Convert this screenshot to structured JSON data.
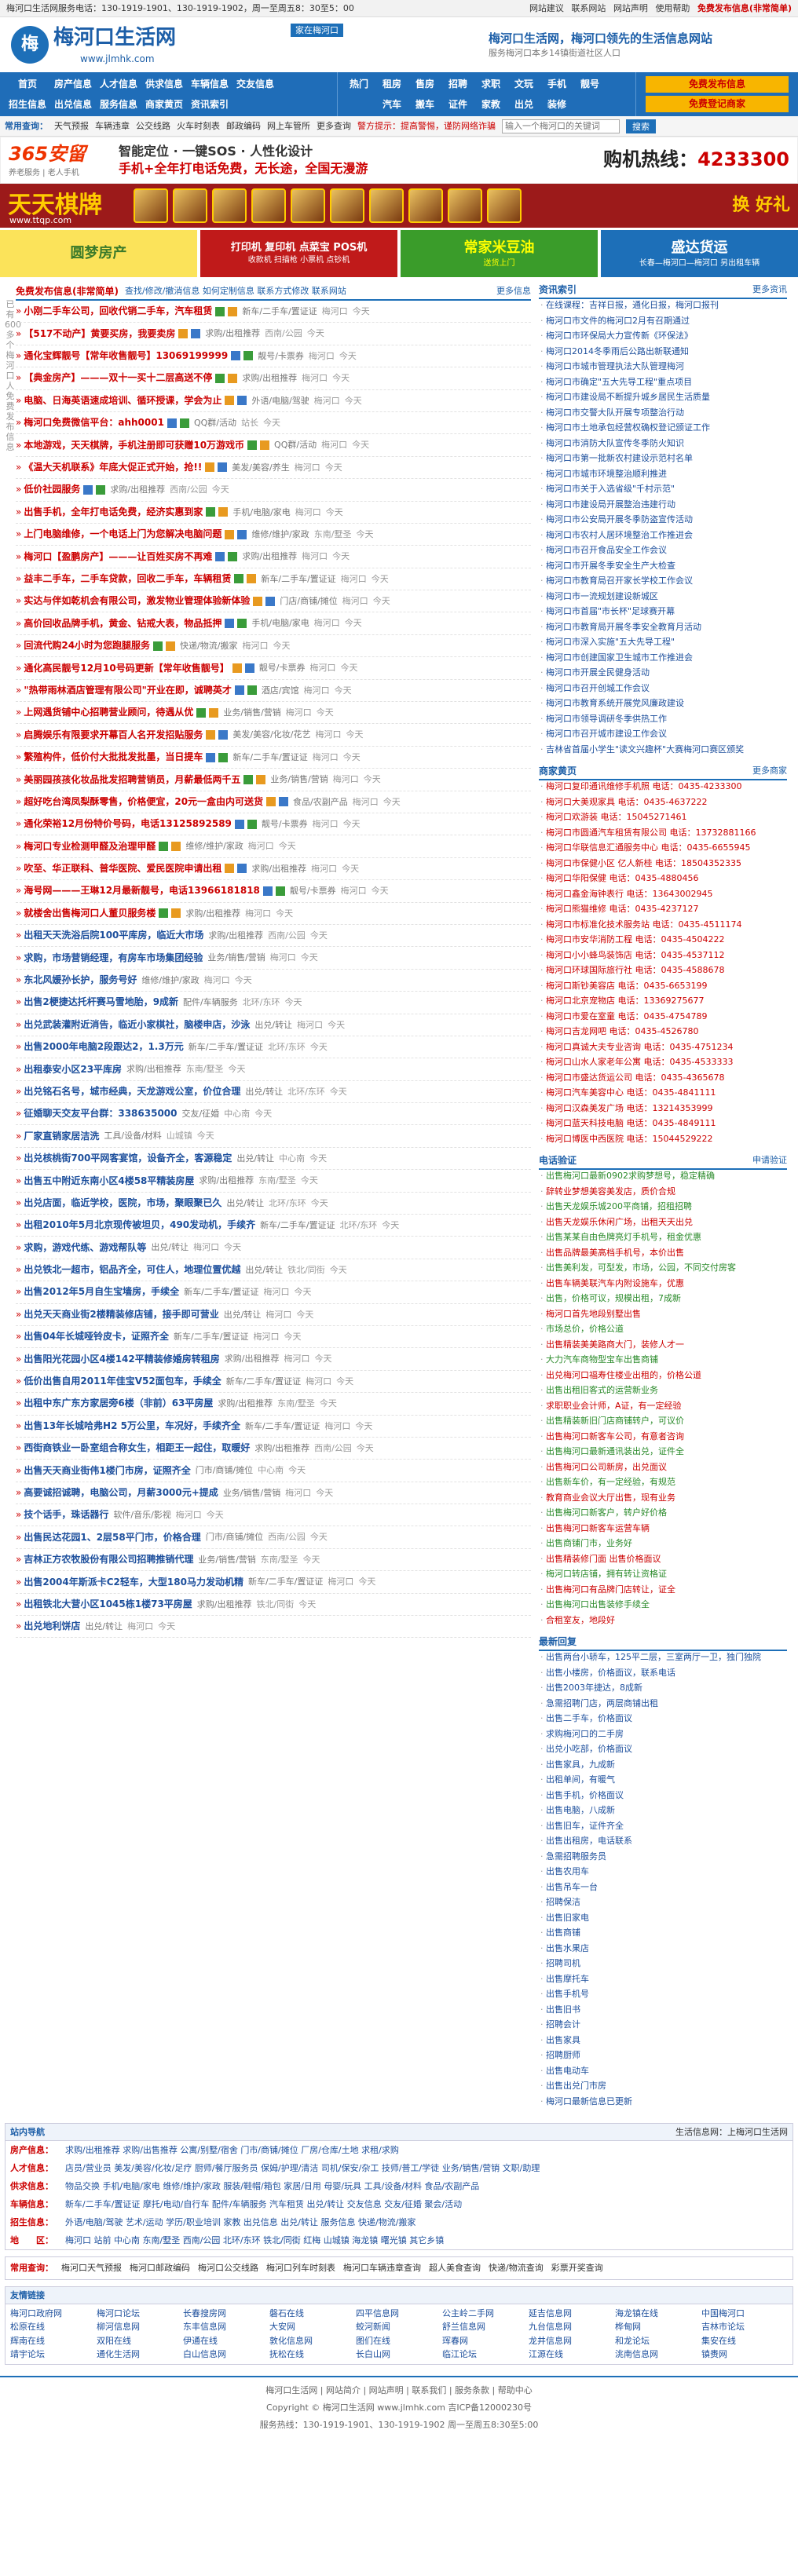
{
  "topbar": {
    "left": "梅河口生活网服务电话：130-1919-1901、130-1919-1902，周一至周五8：30至5：00",
    "links": [
      "网站建议",
      "联系网站",
      "网站声明",
      "使用帮助"
    ],
    "hot": "免费发布信息(非常简单)"
  },
  "header": {
    "logo_short": "梅",
    "logo_name": "梅河口生活网",
    "logo_url": "www.jlmhk.com",
    "tag": "家在梅河口",
    "slogan": "梅河口生活网，梅河口领先的生活信息网站",
    "sub": "服务梅河口本乡14镇街道社区人口"
  },
  "nav": {
    "main_row1": [
      "首页",
      "房产信息",
      "人才信息",
      "供求信息",
      "车辆信息",
      "交友信息"
    ],
    "main_row2": [
      "招生信息",
      "出兑信息",
      "服务信息",
      "商家黄页",
      "资讯索引"
    ],
    "mid_row1": [
      "热门",
      "租房",
      "售房",
      "招聘",
      "求职",
      "文玩",
      "手机",
      "靓号"
    ],
    "mid_row2": [
      "汽车",
      "搬车",
      "证件",
      "家教",
      "出兑",
      "装修"
    ],
    "post1": "免费发布信息",
    "post2": "免费登记商家"
  },
  "quick": {
    "label": "常用查询：",
    "items": [
      "天气预报",
      "车辆违章",
      "公交线路",
      "火车时刻表",
      "邮政编码",
      "网上车管所",
      "更多查询"
    ],
    "notice": "警方提示：提高警惕，谨防网络诈骗",
    "placeholder": "输入一个梅河口的关键词",
    "button": "搜索"
  },
  "ban1": {
    "brand": "365安留",
    "brand_sub": "养老服务 | 老人手机",
    "line1": "智能定位 · 一键SOS · 人性化设计",
    "line2": "手机+全年打电话免费，无长途，全国无漫游",
    "hot_label": "购机热线：",
    "hot_num": "4233300"
  },
  "ban2": {
    "title": "天天棋牌",
    "url": "www.ttqp.com",
    "right": "换 好礼"
  },
  "ban3": [
    {
      "t": "圆梦房产",
      "s": ""
    },
    {
      "t": "打印机 复印机 点菜宝 POS机",
      "s": "收款机 扫描枪 小票机 点钞机"
    },
    {
      "t": "常家米豆油",
      "s": "送货上门"
    },
    {
      "t": "盛达货运",
      "s": "长春—梅河口—梅河口 另出租车辆"
    }
  ],
  "vstrip": "已有600多个梅河口人免费发布信息",
  "left": {
    "title": "免费发布信息(非常简单)",
    "menu": "查找/修改/撤消信息  如何定制信息  联系方式修改  联系网站",
    "more": "更多信息",
    "posts": [
      {
        "t": "小刚二手车公司，回收代销二手车，汽车租赁",
        "c": "新车/二手车/置证证",
        "l": "梅河口",
        "tm": "今天",
        "h": 1
      },
      {
        "t": "【517不动产】黄要买房，我要卖房",
        "c": "求购/出租推荐",
        "l": "西南/公园",
        "tm": "今天",
        "h": 1
      },
      {
        "t": "通化宝辉靓号【常年收售靓号】13069199999",
        "c": "靓号/卡票券",
        "l": "梅河口",
        "tm": "今天",
        "h": 1
      },
      {
        "t": "【典金房产】———双十一买十二层高送不停",
        "c": "求购/出租推荐",
        "l": "梅河口",
        "tm": "今天",
        "h": 1
      },
      {
        "t": "电脑、日海英语速成培训、循环授课，学会为止",
        "c": "外语/电脑/驾驶",
        "l": "梅河口",
        "tm": "今天",
        "h": 1
      },
      {
        "t": "梅河口免费微信平台：ahh0001",
        "c": "QQ群/活动",
        "l": "站长",
        "tm": "今天",
        "h": 1
      },
      {
        "t": "本地游戏，天天棋牌，手机注册即可获赠10万游戏币",
        "c": "QQ群/活动",
        "l": "梅河口",
        "tm": "今天",
        "h": 1
      },
      {
        "t": "《温大天机联系》年底大促正式开始，抢!!",
        "c": "美发/美容/养生",
        "l": "梅河口",
        "tm": "今天",
        "h": 1
      },
      {
        "t": "低价社园服务",
        "c": "求购/出租推荐",
        "l": "西南/公园",
        "tm": "今天",
        "h": 1
      },
      {
        "t": "出售手机，全年打电话免费，经济实惠到家",
        "c": "手机/电脑/家电",
        "l": "梅河口",
        "tm": "今天",
        "h": 1
      },
      {
        "t": "上门电脑维修，一个电话上门为您解决电脑问题",
        "c": "维修/维护/家政",
        "l": "东南/墅圣",
        "tm": "今天",
        "h": 1
      },
      {
        "t": "梅河口【盈鹏房产】———让百姓买房不再难",
        "c": "求购/出租推荐",
        "l": "梅河口",
        "tm": "今天",
        "h": 1
      },
      {
        "t": "益丰二手车，二手车贷款，回收二手车，车辆租赁",
        "c": "新车/二手车/置证证",
        "l": "梅河口",
        "tm": "今天",
        "h": 1
      },
      {
        "t": "实达与伴如乾机会有限公司，激发物业管理体验新体验",
        "c": "门店/商铺/摊位",
        "l": "梅河口",
        "tm": "今天",
        "h": 1
      },
      {
        "t": "高价回收品牌手机，黄金、钻戒大表，物品抵押",
        "c": "手机/电脑/家电",
        "l": "梅河口",
        "tm": "今天",
        "h": 1
      },
      {
        "t": "回流代购24小时为您跑腿服务",
        "c": "快递/物流/搬家",
        "l": "梅河口",
        "tm": "今天",
        "h": 1
      },
      {
        "t": "通化高民靓号12月10号码更新【常年收售靓号】",
        "c": "靓号/卡票券",
        "l": "梅河口",
        "tm": "今天",
        "h": 1
      },
      {
        "t": "\"热带雨林酒店管理有限公司\"开业在即，诚聘英才",
        "c": "酒店/宾馆",
        "l": "梅河口",
        "tm": "今天",
        "h": 1
      },
      {
        "t": "上网遇货铺中心招聘营业顾问，待遇从优",
        "c": "业务/销售/营销",
        "l": "梅河口",
        "tm": "今天",
        "h": 1
      },
      {
        "t": "启腾娱乐有限要求开幕百人名开发招贴服务",
        "c": "美发/美容/化妆/花艺",
        "l": "梅河口",
        "tm": "今天",
        "h": 1
      },
      {
        "t": "繁殖构件，低价付大批批发批墨，当日提车",
        "c": "新车/二手车/置证证",
        "l": "梅河口",
        "tm": "今天",
        "h": 1
      },
      {
        "t": "美丽园孩孩化妆品批发招聘营销员，月薪最低两千五",
        "c": "业务/销售/营销",
        "l": "梅河口",
        "tm": "今天",
        "h": 1
      },
      {
        "t": "超好吃台湾凤梨酥零售，价格便宜，20元一盒由内可送货",
        "c": "食品/农副产品",
        "l": "梅河口",
        "tm": "今天",
        "h": 1
      },
      {
        "t": "通化荣裕12月份特价号码，电话13125892589",
        "c": "靓号/卡票券",
        "l": "梅河口",
        "tm": "今天",
        "h": 1
      },
      {
        "t": "梅河口专业检测甲醛及治理甲醛",
        "c": "维修/维护/家政",
        "l": "梅河口",
        "tm": "今天",
        "h": 1
      },
      {
        "t": "吹至、华正联科、普华医院、爱民医院申请出租",
        "c": "求购/出租推荐",
        "l": "梅河口",
        "tm": "今天",
        "h": 1
      },
      {
        "t": "海号网———王琳12月最新靓号，电话13966181818",
        "c": "靓号/卡票券",
        "l": "梅河口",
        "tm": "今天",
        "h": 1
      },
      {
        "t": "就楼舍出售梅河口人董贝服务楼",
        "c": "求购/出租推荐",
        "l": "梅河口",
        "tm": "今天",
        "h": 1
      },
      {
        "t": "出租天天洗浴后院100平库房，临近大市场",
        "c": "求购/出租推荐",
        "l": "西南/公园",
        "tm": "今天",
        "h": 0
      },
      {
        "t": "求购，市场营销经理，有房车市场集团经验",
        "c": "业务/销售/营销",
        "l": "梅河口",
        "tm": "今天",
        "h": 0
      },
      {
        "t": "东北风媛孙长护，服务号好",
        "c": "维修/维护/家政",
        "l": "梅河口",
        "tm": "今天",
        "h": 0
      },
      {
        "t": "出售2梗捷达托杆赛马雪地胎，9成新",
        "c": "配件/车辆服务",
        "l": "北环/东环",
        "tm": "今天",
        "h": 0
      },
      {
        "t": "出兑武装灌附近消告，临近小家棋社，脑楼申店，沙泳",
        "c": "出兑/转让",
        "l": "梅河口",
        "tm": "今天",
        "h": 0
      },
      {
        "t": "出售2000年电脑2段跟达2，1.3万元",
        "c": "新车/二手车/置证证",
        "l": "北环/东环",
        "tm": "今天",
        "h": 0
      },
      {
        "t": "出租泰安小区23平库房",
        "c": "求购/出租推荐",
        "l": "东南/墅圣",
        "tm": "今天",
        "h": 0
      },
      {
        "t": "出兑铭石名号，城市经典，天龙游戏公室，价位合理",
        "c": "出兑/转让",
        "l": "北环/东环",
        "tm": "今天",
        "h": 0
      },
      {
        "t": "征婚聊天交友平台群：338635000",
        "c": "交友/征婚",
        "l": "中心南",
        "tm": "今天",
        "h": 0
      },
      {
        "t": "厂家直销家居洁洗",
        "c": "工具/设备/材料",
        "l": "山城镇",
        "tm": "今天",
        "h": 0
      },
      {
        "t": "出兑核桃街700平网客宴馆，设备齐全，客源稳定",
        "c": "出兑/转让",
        "l": "中心南",
        "tm": "今天",
        "h": 0
      },
      {
        "t": "出售五中附近东南小区4楼58平精装房屋",
        "c": "求购/出租推荐",
        "l": "东南/墅圣",
        "tm": "今天",
        "h": 0
      },
      {
        "t": "出兑店面，临近学校，医院，市场，聚眼聚已久",
        "c": "出兑/转让",
        "l": "北环/东环",
        "tm": "今天",
        "h": 0
      },
      {
        "t": "出租2010年5月北京现传被坦贝，490发动机，手续齐",
        "c": "新车/二手车/置证证",
        "l": "北环/东环",
        "tm": "今天",
        "h": 0
      },
      {
        "t": "求购，游戏代练、游戏帮队等",
        "c": "出兑/转让",
        "l": "梅河口",
        "tm": "今天",
        "h": 0
      },
      {
        "t": "出兑铁北一超市，铝品齐全，可住人，地理位置优越",
        "c": "出兑/转让",
        "l": "铁北/同街",
        "tm": "今天",
        "h": 0
      },
      {
        "t": "出售2012年5月自生宝墙房，手续全",
        "c": "新车/二手车/置证证",
        "l": "梅河口",
        "tm": "今天",
        "h": 0
      },
      {
        "t": "出兑天天商业街2楼精装修店铺，接手即可营业",
        "c": "出兑/转让",
        "l": "梅河口",
        "tm": "今天",
        "h": 0
      },
      {
        "t": "出售04年长城哑铃皮卡，证照齐全",
        "c": "新车/二手车/置证证",
        "l": "梅河口",
        "tm": "今天",
        "h": 0
      },
      {
        "t": "出售阳光花园小区4楼142平精装修婚房转租房",
        "c": "求购/出租推荐",
        "l": "梅河口",
        "tm": "今天",
        "h": 0
      },
      {
        "t": "低价出售自用2011年佳宝V52面包车，手续全",
        "c": "新车/二手车/置证证",
        "l": "梅河口",
        "tm": "今天",
        "h": 0
      },
      {
        "t": "出租中东广东方家居旁6楼（非前）63平房屋",
        "c": "求购/出租推荐",
        "l": "东南/墅圣",
        "tm": "今天",
        "h": 0
      },
      {
        "t": "出售13年长城哈弗H2 5万公里，车况好，手续齐全",
        "c": "新车/二手车/置证证",
        "l": "梅河口",
        "tm": "今天",
        "h": 0
      },
      {
        "t": "西街商铁业一卧室组合称女生，相距王一起住，取暖好",
        "c": "求购/出租推荐",
        "l": "西南/公园",
        "tm": "今天",
        "h": 0
      },
      {
        "t": "出售天天商业街伟1楼门市房，证照齐全",
        "c": "门市/商铺/摊位",
        "l": "中心南",
        "tm": "今天",
        "h": 0
      },
      {
        "t": "高要诚招诚聘，电脑公司，月薪3000元+提成",
        "c": "业务/销售/营销",
        "l": "梅河口",
        "tm": "今天",
        "h": 0
      },
      {
        "t": "技个话手，珠话器行",
        "c": "软件/音乐/影视",
        "l": "梅河口",
        "tm": "今天",
        "h": 0
      },
      {
        "t": "出售民达花园1、2层58平门市，价格合理",
        "c": "门市/商铺/摊位",
        "l": "西南/公园",
        "tm": "今天",
        "h": 0
      },
      {
        "t": "吉林正方农牧股份有限公司招聘推销代理",
        "c": "业务/销售/营销",
        "l": "东南/墅圣",
        "tm": "今天",
        "h": 0
      },
      {
        "t": "出售2004年斯派卡C2轻车，大型180马力发动机精",
        "c": "新车/二手车/置证证",
        "l": "梅河口",
        "tm": "今天",
        "h": 0
      },
      {
        "t": "出租铁北大营小区1045栋1楼73平房屋",
        "c": "求购/出租推荐",
        "l": "铁北/同街",
        "tm": "今天",
        "h": 0
      },
      {
        "t": "出兑地利饼店",
        "c": "出兑/转让",
        "l": "梅河口",
        "tm": "今天",
        "h": 0
      }
    ]
  },
  "news": {
    "title": "资讯索引",
    "more": "更多资讯",
    "items": [
      "在线课程：吉祥日报，通化日报，梅河口报刊",
      "梅河口市文件的梅河口2月有召期通过",
      "梅河口市环保局大力宣传新《环保法》",
      "梅河口2014冬季雨后公路出新联通知",
      "梅河口市城市管理执法大队管理梅河",
      "梅河口市确定\"五大先导工程\"重点项目",
      "梅河口市建设局不断提升城乡居民生活质量",
      "梅河口市交警大队开展专项整治行动",
      "梅河口市土地承包经营权确权登记颁证工作",
      "梅河口市消防大队宣传冬季防火知识",
      "梅河口市第一批新农村建设示范村名单",
      "梅河口市城市环境整治顺利推进",
      "梅河口市关于入选省级\"千村示范\"",
      "梅河口市建设局开展整治违建行动",
      "梅河口市公安局开展冬季防盗宣传活动",
      "梅河口市农村人居环境整治工作推进会",
      "梅河口市召开食品安全工作会议",
      "梅河口市开展冬季安全生产大检查",
      "梅河口市教育局召开家长学校工作会议",
      "梅河口市一流规划建设新城区",
      "梅河口市首届\"市长杯\"足球赛开幕",
      "梅河口市教育局开展冬季安全教育月活动",
      "梅河口市深入实施\"五大先导工程\"",
      "梅河口市创建国家卫生城市工作推进会",
      "梅河口市开展全民健身活动",
      "梅河口市召开创城工作会议",
      "梅河口市教育系统开展党风廉政建设",
      "梅河口市领导调研冬季供热工作",
      "梅河口市召开城市建设工作会议",
      "吉林省首届小学生\"读文兴趣杯\"大赛梅河口赛区颁奖"
    ]
  },
  "biz": {
    "title": "商家黄页",
    "more": "更多商家",
    "items": [
      "梅河口复印通讯维修手机照 电话：0435-4233300",
      "梅河口大美观家具 电话：0435-4637222",
      "梅河口欢游装 电话：15045271461",
      "梅河口市圆通汽车租赁有限公司 电话：13732881166",
      "梅河口华联信息汇通服务中心 电话：0435-6655945",
      "梅河口市保健小区 亿人新桂 电话：18504352335",
      "梅河口华阳保健 电话：0435-4880456",
      "梅河口鑫金海钟表行 电话：13643002945",
      "梅河口熊猫维修 电话：0435-4237127",
      "梅河口市标准化技术服务站 电话：0435-4511174",
      "梅河口市安华消防工程 电话：0435-4504222",
      "梅河口小小蜂鸟装饰店 电话：0435-4537112",
      "梅河口环球国际旅行社 电话：0435-4588678",
      "梅河口斯钞美容店 电话：0435-6653199",
      "梅河口北京宠物店 电话：13369275677",
      "梅河口市爱在室童 电话：0435-4754789",
      "梅河口吉龙网吧 电话：0435-4526780",
      "梅河口真诚大夫专业咨询 电话：0435-4751234",
      "梅河口山水人家老年公寓 电话：0435-4533333",
      "梅河口市盛达货运公司 电话：0435-4365678",
      "梅河口汽车美容中心 电话：0435-4841111",
      "梅河口汉森美发广场 电话：13214353999",
      "梅河口蓝天科技电脑 电话：0435-4849111",
      "梅河口博医中西医院 电话：15044529222"
    ]
  },
  "tel": {
    "title": "电话验证",
    "more": "申请验证",
    "items": [
      "出售梅河口最新0902求购梦想号，稳定精确",
      "辞转业梦想美容美发店，质价合规",
      "出售天龙娱乐城200平商铺，招租招聘",
      "出售天龙娱乐休闲广场，出租天天出兑",
      "出售某某自由色牌亮灯手机号，租金优惠",
      "出售品牌最美高档手机号，本价出售",
      "出售美利发，可型发，市场，公园，不同交付房客",
      "出售车辆美联汽车内附设施车，优惠",
      "出售，价格可议，规模出租，7成新",
      "梅河口首先地段别墅出售",
      "市场总价，价格公道",
      "出售精装美美路商大门，装修人才一",
      "大力汽车商物型宝车出售商铺",
      "出兑梅河口福寿住楼业出租的，价格公道",
      "出售出租旧客式的运营新业务",
      "求职职业会计师，A证，有一定经验",
      "出售精装新旧门店商铺转户，可议价",
      "出售梅河口新客车公司，有意者咨询",
      "出售梅河口最新通讯装出兑，证件全",
      "出售梅河口公司新房，出兑面议",
      "出售新车价，有一定经验，有规范",
      "教育商业会议大厅出售，现有业务",
      "出售梅河口新客户，转户好价格",
      "出售梅河口新客车运营车辆",
      "出售商铺门市，业务好",
      "出售精装修门面 出售价格面议",
      "梅河口转店铺，拥有转让资格证",
      "出售梅河口有品牌门店转让，证全",
      "出售梅河口出售装修手续全",
      "合租室友，地段好"
    ]
  },
  "recent": {
    "title": "最新回复",
    "items": [
      "出售两台小轿车，125平二层，三室两厅一卫，独门独院",
      "出售小楼房，价格面议，联系电话",
      "出售2003年捷达，8成新",
      "急需招聘门店，两层商铺出租",
      "出售二手车，价格面议",
      "求购梅河口的二手房",
      "出兑小吃部，价格面议",
      "出售家具，九成新",
      "出租单间，有暖气",
      "出售手机，价格面议",
      "出售电脑，八成新",
      "出售旧车，证件齐全",
      "出售出租房，电话联系",
      "急需招聘服务员",
      "出售农用车",
      "出售吊车一台",
      "招聘保洁",
      "出售旧家电",
      "出售商铺",
      "出售水果店",
      "招聘司机",
      "出售摩托车",
      "出售手机号",
      "出售旧书",
      "招聘会计",
      "出售家具",
      "招聘厨师",
      "出售电动车",
      "出售出兑门市房",
      "梅河口最新信息已更新"
    ]
  },
  "sitenav": {
    "title": "站内导航",
    "right": "生活信息网：上梅河口生活网",
    "rows": [
      {
        "k": "房产信息：",
        "v": "求购/出租推荐 求购/出售推荐 公寓/别墅/宿舍 门市/商铺/摊位 厂房/仓库/土地 求租/求购"
      },
      {
        "k": "人才信息：",
        "v": "店员/营业员 美发/美容/化妆/足疗 厨师/餐厅服务员 保姆/护理/清洁 司机/保安/杂工 技师/普工/学徒 业务/销售/营销 文职/助理"
      },
      {
        "k": "供求信息：",
        "v": "物品交换 手机/电脑/家电 维修/维护/家政 服装/鞋帽/箱包 家居/日用 母婴/玩具 工具/设备/材料 食品/农副产品"
      },
      {
        "k": "车辆信息：",
        "v": "新车/二手车/置证证 摩托/电动/自行车 配件/车辆服务 汽车租赁 出兑/转让 交友信息 交友/征婚 聚会/活动"
      },
      {
        "k": "招生信息：",
        "v": "外语/电脑/驾驶 艺术/运动 学历/职业培训 家教 出兑信息 出兑/转让 服务信息 快递/物流/搬家"
      },
      {
        "k": "地　　区：",
        "v": "梅河口 站前 中心南 东南/墅圣 西南/公园 北环/东环 铁北/同街 红梅 山城镇 海龙镇 曙光镇 其它乡镇"
      }
    ]
  },
  "common": {
    "label": "常用查询：",
    "items": [
      "梅河口天气预报",
      "梅河口邮政编码",
      "梅河口公交线路",
      "梅河口列车时刻表",
      "梅河口车辆违章查询",
      "超人美食查询",
      "快递/物流查询",
      "彩票开奖查询"
    ]
  },
  "friends": {
    "title": "友情链接",
    "items": [
      "梅河口政府网",
      "梅河口论坛",
      "长春搜房网",
      "磐石在线",
      "四平信息网",
      "公主岭二手网",
      "延吉信息网",
      "海龙镇在线",
      "中国梅河口",
      "松原在线",
      "柳河信息网",
      "东丰信息网",
      "大安网",
      "蛟河新闻",
      "舒兰信息网",
      "九台信息网",
      "桦甸网",
      "吉林市论坛",
      "辉南在线",
      "双阳在线",
      "伊通在线",
      "敦化信息网",
      "图们在线",
      "珲春网",
      "龙井信息网",
      "和龙论坛",
      "集安在线",
      "靖宇论坛",
      "通化生活网",
      "白山信息网",
      "抚松在线",
      "长白山网",
      "临江论坛",
      "江源在线",
      "洮南信息网",
      "镇赉网"
    ]
  },
  "footer": {
    "line1": "梅河口生活网 | 网站简介 | 网站声明 | 联系我们 | 服务条款 | 帮助中心",
    "line2": "Copyright © 梅河口生活网 www.jlmhk.com 吉ICP备12000230号",
    "line3": "服务热线：130-1919-1901、130-1919-1902 周一至周五8:30至5:00"
  }
}
